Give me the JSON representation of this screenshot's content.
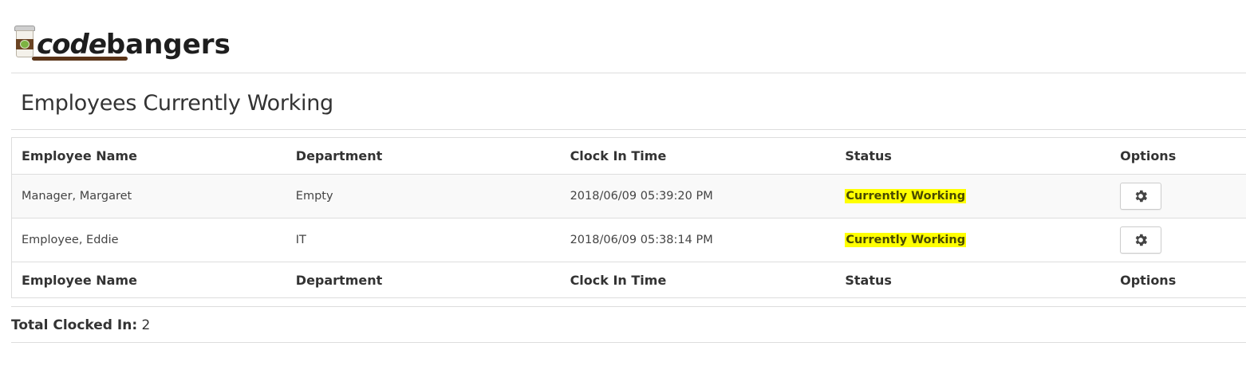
{
  "brand": {
    "logo_text": "codebangers",
    "part1": "code",
    "part2": "bangers"
  },
  "page_title": "Employees Currently Working",
  "table": {
    "columns": [
      "Employee Name",
      "Department",
      "Clock In Time",
      "Status",
      "Options"
    ],
    "rows": [
      {
        "name": "Manager, Margaret",
        "department": "Empty",
        "clock_in": "2018/06/09 05:39:20 PM",
        "status": "Currently Working",
        "option_icon": "gear-icon"
      },
      {
        "name": "Employee, Eddie",
        "department": "IT",
        "clock_in": "2018/06/09 05:38:14 PM",
        "status": "Currently Working",
        "option_icon": "gear-icon"
      }
    ]
  },
  "summary": {
    "label": "Total Clocked In:",
    "value": "2"
  },
  "colors": {
    "status_highlight": "#ffff00",
    "border": "#dddddd",
    "stripe": "#f9f9f9"
  }
}
